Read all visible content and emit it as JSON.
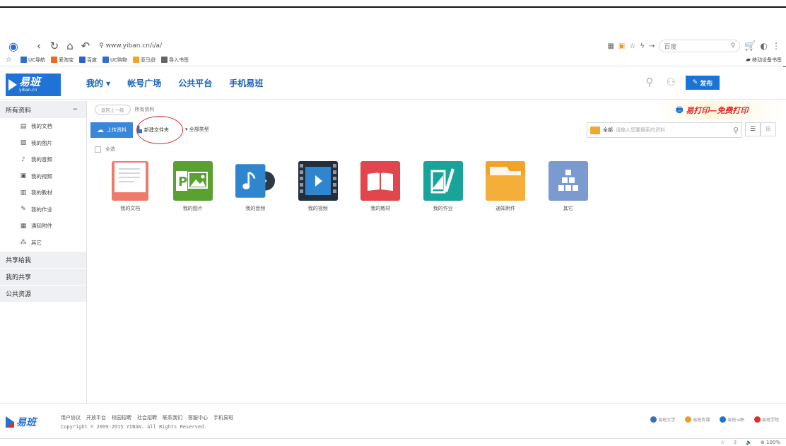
{
  "browser": {
    "back": "‹",
    "forward": "›",
    "refresh": "↻",
    "home": "⌂",
    "undo": "↶",
    "url": "www.yiban.cn/i/a/",
    "search_engine": "百度",
    "bookmarks": [
      {
        "label": "UC导航",
        "color": "#2f6fd1"
      },
      {
        "label": "爱淘宝",
        "color": "#f06a1d"
      },
      {
        "label": "百度",
        "color": "#2b64c9"
      },
      {
        "label": "UC购物",
        "color": "#2f6fd1"
      },
      {
        "label": "亚马逊",
        "color": "#f2a61b"
      },
      {
        "label": "导入书签",
        "color": "#666666"
      }
    ],
    "mobile_bookmarks": "移动设备书签"
  },
  "app": {
    "logo_text": "易班",
    "logo_sub": "yiban.cn",
    "nav": [
      "我的 ▾",
      "帐号广场",
      "公共平台",
      "手机易班"
    ],
    "publish_label": "发布"
  },
  "sidebar": {
    "header": "所有资料",
    "header_toggle": "−",
    "items": [
      {
        "label": "我的文档",
        "icon": "▤"
      },
      {
        "label": "我的图片",
        "icon": "▨"
      },
      {
        "label": "我的音频",
        "icon": "♪"
      },
      {
        "label": "我的视频",
        "icon": "▣"
      },
      {
        "label": "我的教材",
        "icon": "▥"
      },
      {
        "label": "我的作业",
        "icon": "✎"
      },
      {
        "label": "通知附件",
        "icon": "▦"
      },
      {
        "label": "其它",
        "icon": "⁂"
      }
    ],
    "sections": [
      "共享给我",
      "我的共享",
      "公共资源"
    ]
  },
  "content": {
    "back_pill": "返回上一级",
    "crumb": "所有资料",
    "promo": "易打印—免费打印",
    "upload_label": "上传资料",
    "new_folder_label": "新建文件夹",
    "all_types_label": "全部类型",
    "search_scope": "全部",
    "search_placeholder": "请输入您要搜索的资料",
    "select_all": "全选",
    "tiles": [
      {
        "label": "我的文档",
        "color": "#ee7b6a"
      },
      {
        "label": "我的图片",
        "color": "#5aa132"
      },
      {
        "label": "我的音频",
        "color": "#2f86cf"
      },
      {
        "label": "我的视频",
        "color": "#1d4f88"
      },
      {
        "label": "我的教材",
        "color": "#e0464b"
      },
      {
        "label": "我的作业",
        "color": "#1aa39b"
      },
      {
        "label": "通知附件",
        "color": "#f3a32a"
      },
      {
        "label": "其它",
        "color": "#7b9bd0"
      }
    ]
  },
  "footer": {
    "logo_text": "易班",
    "links": [
      "用户协议",
      "开放平台",
      "校园招聘",
      "社会招聘",
      "联系我们",
      "客服中心",
      "手机易班"
    ],
    "copyright": "Copyright © 2009-2015 YIBAN. All Rights Reserved.",
    "partners": [
      "易班大学",
      "易班优课",
      "易班·e职",
      "易班学院"
    ]
  },
  "statusbar": {
    "zoom": "100%"
  }
}
